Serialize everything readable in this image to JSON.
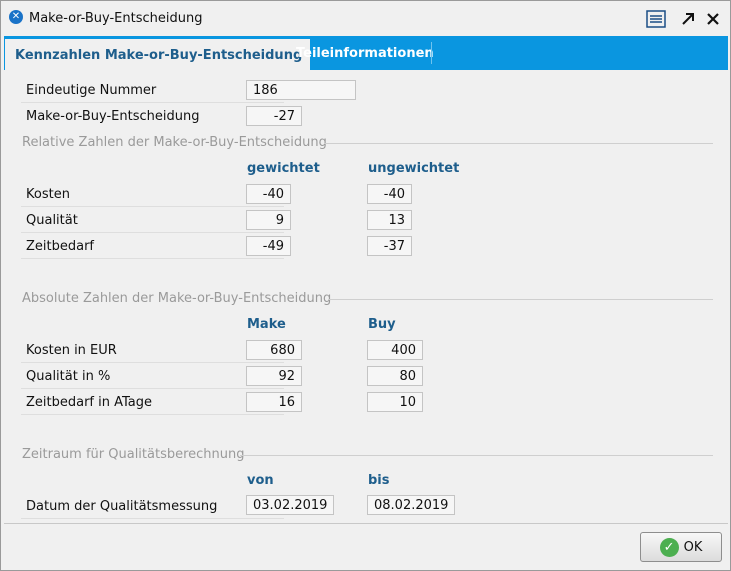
{
  "window": {
    "title": "Make-or-Buy-Entscheidung"
  },
  "icons": {
    "app": "app-logo-icon",
    "list": "list-icon",
    "expand": "expand-arrow-icon",
    "close": "close-icon",
    "ok": "check-circle-icon"
  },
  "tabs": [
    {
      "label": "Kennzahlen Make-or-Buy-Entscheidung",
      "active": true
    },
    {
      "label": "Teileinformationen",
      "active": false
    }
  ],
  "general": {
    "unique_number_label": "Eindeutige Nummer",
    "unique_number_value": "186",
    "decision_label": "Make-or-Buy-Entscheidung",
    "decision_value": "-27"
  },
  "relative": {
    "section_title": "Relative Zahlen der Make-or-Buy-Entscheidung",
    "col_weighted": "gewichtet",
    "col_unweighted": "ungewichtet",
    "rows": [
      {
        "label": "Kosten",
        "weighted": "-40",
        "unweighted": "-40"
      },
      {
        "label": "Qualität",
        "weighted": "9",
        "unweighted": "13"
      },
      {
        "label": "Zeitbedarf",
        "weighted": "-49",
        "unweighted": "-37"
      }
    ]
  },
  "absolute": {
    "section_title": "Absolute Zahlen der Make-or-Buy-Entscheidung",
    "col_make": "Make",
    "col_buy": "Buy",
    "rows": [
      {
        "label": "Kosten in EUR",
        "make": "680",
        "buy": "400"
      },
      {
        "label": "Qualität in %",
        "make": "92",
        "buy": "80"
      },
      {
        "label": "Zeitbedarf in ATage",
        "make": "16",
        "buy": "10"
      }
    ]
  },
  "period": {
    "section_title": "Zeitraum für Qualitätsberechnung",
    "col_from": "von",
    "col_to": "bis",
    "row_label": "Datum der Qualitätsmessung",
    "from": "03.02.2019",
    "to": "08.02.2019"
  },
  "footer": {
    "ok_label": "OK"
  },
  "colors": {
    "accent": "#0a96e0",
    "header_text": "#1e5e8c",
    "ok_icon": "#4caf50"
  }
}
